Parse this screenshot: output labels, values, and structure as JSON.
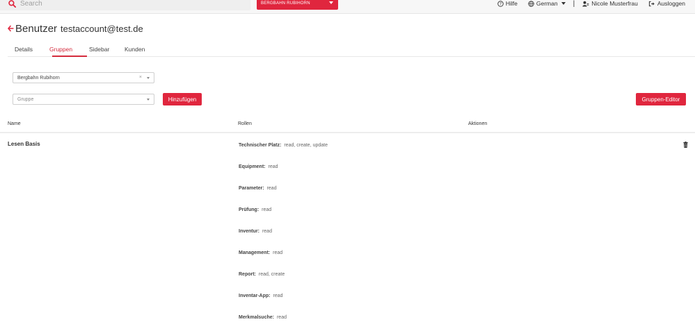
{
  "topbar": {
    "search_placeholder": "Search",
    "tenant": "BERGBAHN RUBIHORN",
    "links": {
      "help": "Hilfe",
      "language": "German",
      "user": "Nicole Musterfrau",
      "logout": "Ausloggen"
    },
    "separator": "|"
  },
  "page": {
    "title": "Benutzer",
    "subtitle": "testaccount@test.de"
  },
  "tabs": [
    {
      "label": "Details"
    },
    {
      "label": "Gruppen"
    },
    {
      "label": "Sidebar"
    },
    {
      "label": "Kunden"
    }
  ],
  "form": {
    "tenant_value": "Bergbahn Rubihorn",
    "clear_symbol": "×",
    "group_placeholder": "Gruppe",
    "add_button": "Hinzufügen",
    "editor_button": "Gruppen-Editor"
  },
  "table": {
    "headers": {
      "name": "Name",
      "roles": "Rollen",
      "actions": "Aktionen"
    },
    "rows": [
      {
        "name": "Lesen Basis",
        "roles": [
          {
            "key": "Technischer Platz:",
            "value": "read,   create,   update"
          },
          {
            "key": "Equipment:",
            "value": "read"
          },
          {
            "key": "Parameter:",
            "value": "read"
          },
          {
            "key": "Prüfung:",
            "value": "read"
          },
          {
            "key": "Inventur:",
            "value": "read"
          },
          {
            "key": "Management:",
            "value": "read"
          },
          {
            "key": "Report:",
            "value": "read,   create"
          },
          {
            "key": "Inventar-App:",
            "value": "read"
          },
          {
            "key": "Merkmalsuche:",
            "value": "read"
          }
        ]
      }
    ]
  },
  "colors": {
    "accent": "#e0263e",
    "tab_active": "#d42a3c"
  }
}
